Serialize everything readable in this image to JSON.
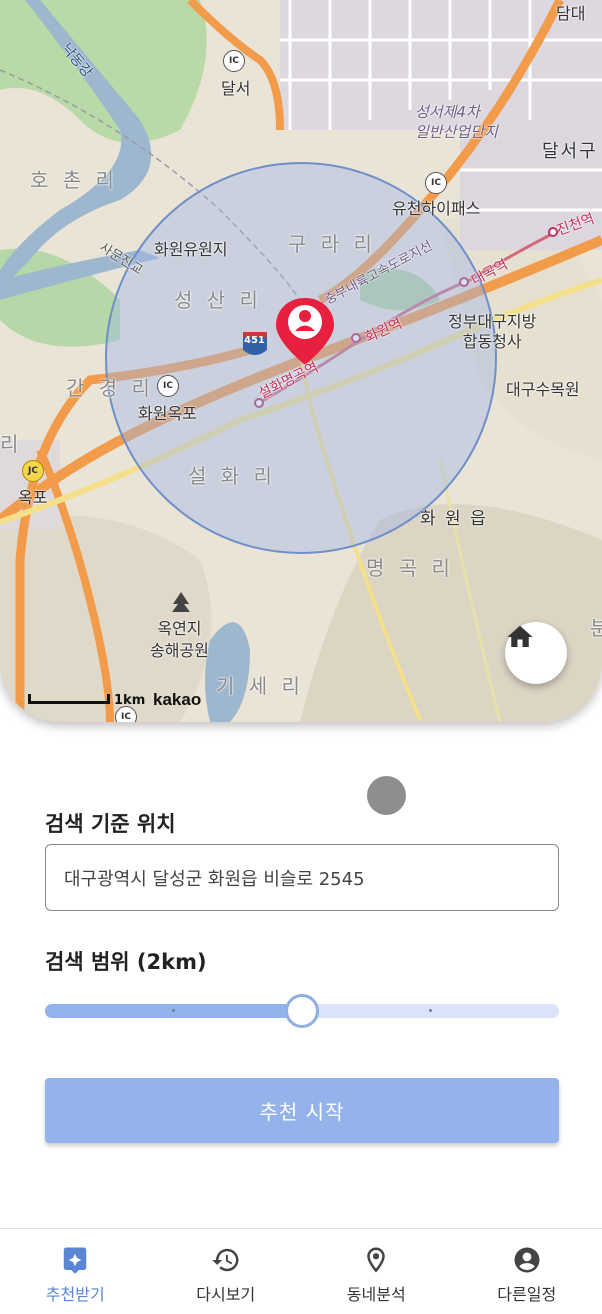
{
  "map": {
    "labels": {
      "nakdong": "낙동강",
      "dalseo_gu": "달서구",
      "dalseo": "달서",
      "dam": "담대",
      "seongseo": "성서제4차\n일반산업단지",
      "hochon": "호 촌 리",
      "hwawon_park": "화원유원지",
      "gurari": "구 라 리",
      "seongsan": "성 산 리",
      "yuncheon": "유천하이패스",
      "jinchun": "진천역",
      "daegok": "대곡역",
      "hwawon_station": "화원역",
      "seolhwa_station": "설화명곡역",
      "expressway": "중부내륙고속도로지선",
      "government": "정부대구지방\n합동청사",
      "arboretum": "대구수목원",
      "ganggyeong": "간 경 리",
      "hwawon_okpo": "화원옥포",
      "seolhwari": "설 화 리",
      "hwawon_eup": "화 원 읍",
      "myeonggok": "명 곡 리",
      "okpo": "옥포",
      "okyeonji": "옥연지\n송해공원",
      "giseri": "기 세 리",
      "sm_bridge": "사문진교",
      "route": "451",
      "ri_left": "리",
      "bun": "분"
    },
    "scale": "1km",
    "logo": "kakao",
    "ic_label": "IC",
    "jc_label": "JC"
  },
  "search": {
    "location_title": "검색 기준 위치",
    "address_value": "대구광역시 달성군 화원읍 비슬로 2545",
    "range_title": "검색 범위 (2km)",
    "range_value": 0.5,
    "start_label": "추천 시작"
  },
  "nav": {
    "items": [
      {
        "label": "추천받기",
        "icon": "recommend-icon",
        "active": true
      },
      {
        "label": "다시보기",
        "icon": "history-icon",
        "active": false
      },
      {
        "label": "동네분석",
        "icon": "location-pin-icon",
        "active": false
      },
      {
        "label": "다른일정",
        "icon": "account-icon",
        "active": false
      }
    ]
  },
  "colors": {
    "accent": "#5b86d6",
    "button": "#93b3ea",
    "marker": "#e8203f",
    "radius_circle": "#9db4e6"
  }
}
